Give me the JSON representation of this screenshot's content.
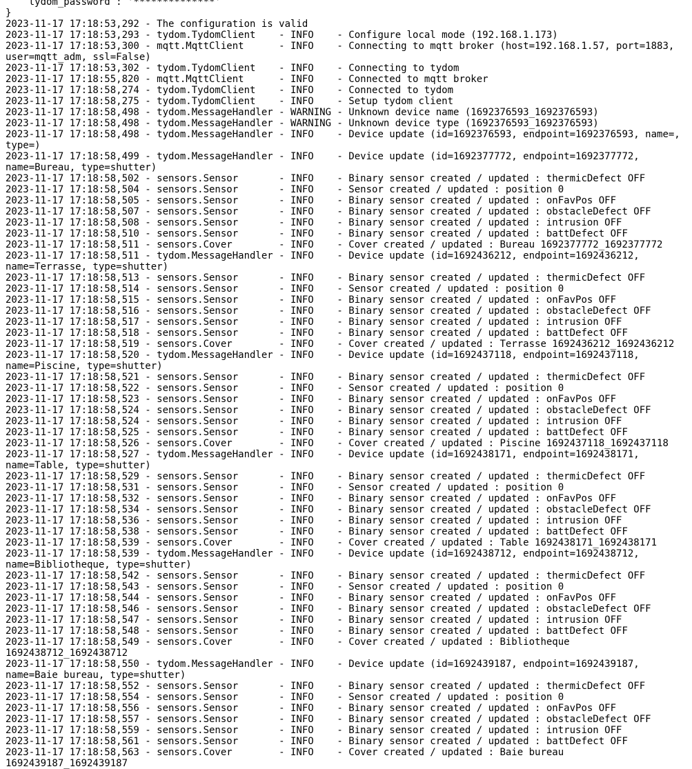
{
  "colors": {
    "background": "#ffffff",
    "text": "#000000"
  },
  "terminal": {
    "rows": [
      "    tydom_password : '**************'",
      "}",
      "2023-11-17 17:18:53,292 - The configuration is valid",
      "2023-11-17 17:18:53,293 - tydom.TydomClient    - INFO    - Configure local mode (192.168.1.173)",
      "2023-11-17 17:18:53,300 - mqtt.MqttClient      - INFO    - Connecting to mqtt broker (host=192.168.1.57, port=1883,",
      "user=mqtt_adm, ssl=False)",
      "2023-11-17 17:18:53,302 - tydom.TydomClient    - INFO    - Connecting to tydom",
      "2023-11-17 17:18:55,820 - mqtt.MqttClient      - INFO    - Connected to mqtt broker",
      "2023-11-17 17:18:58,274 - tydom.TydomClient    - INFO    - Connected to tydom",
      "2023-11-17 17:18:58,275 - tydom.TydomClient    - INFO    - Setup tydom client",
      "2023-11-17 17:18:58,498 - tydom.MessageHandler - WARNING - Unknown device name (1692376593_1692376593)",
      "2023-11-17 17:18:58,498 - tydom.MessageHandler - WARNING - Unknown device type (1692376593_1692376593)",
      "2023-11-17 17:18:58,498 - tydom.MessageHandler - INFO    - Device update (id=1692376593, endpoint=1692376593, name=,",
      "type=)",
      "2023-11-17 17:18:58,499 - tydom.MessageHandler - INFO    - Device update (id=1692377772, endpoint=1692377772,",
      "name=Bureau, type=shutter)",
      "2023-11-17 17:18:58,502 - sensors.Sensor       - INFO    - Binary sensor created / updated : thermicDefect OFF",
      "2023-11-17 17:18:58,504 - sensors.Sensor       - INFO    - Sensor created / updated : position 0",
      "2023-11-17 17:18:58,505 - sensors.Sensor       - INFO    - Binary sensor created / updated : onFavPos OFF",
      "2023-11-17 17:18:58,507 - sensors.Sensor       - INFO    - Binary sensor created / updated : obstacleDefect OFF",
      "2023-11-17 17:18:58,508 - sensors.Sensor       - INFO    - Binary sensor created / updated : intrusion OFF",
      "2023-11-17 17:18:58,510 - sensors.Sensor       - INFO    - Binary sensor created / updated : battDefect OFF",
      "2023-11-17 17:18:58,511 - sensors.Cover        - INFO    - Cover created / updated : Bureau 1692377772_1692377772",
      "2023-11-17 17:18:58,511 - tydom.MessageHandler - INFO    - Device update (id=1692436212, endpoint=1692436212,",
      "name=Terrasse, type=shutter)",
      "2023-11-17 17:18:58,513 - sensors.Sensor       - INFO    - Binary sensor created / updated : thermicDefect OFF",
      "2023-11-17 17:18:58,514 - sensors.Sensor       - INFO    - Sensor created / updated : position 0",
      "2023-11-17 17:18:58,515 - sensors.Sensor       - INFO    - Binary sensor created / updated : onFavPos OFF",
      "2023-11-17 17:18:58,516 - sensors.Sensor       - INFO    - Binary sensor created / updated : obstacleDefect OFF",
      "2023-11-17 17:18:58,517 - sensors.Sensor       - INFO    - Binary sensor created / updated : intrusion OFF",
      "2023-11-17 17:18:58,518 - sensors.Sensor       - INFO    - Binary sensor created / updated : battDefect OFF",
      "2023-11-17 17:18:58,519 - sensors.Cover        - INFO    - Cover created / updated : Terrasse 1692436212_1692436212",
      "2023-11-17 17:18:58,520 - tydom.MessageHandler - INFO    - Device update (id=1692437118, endpoint=1692437118,",
      "name=Piscine, type=shutter)",
      "2023-11-17 17:18:58,521 - sensors.Sensor       - INFO    - Binary sensor created / updated : thermicDefect OFF",
      "2023-11-17 17:18:58,522 - sensors.Sensor       - INFO    - Sensor created / updated : position 0",
      "2023-11-17 17:18:58,523 - sensors.Sensor       - INFO    - Binary sensor created / updated : onFavPos OFF",
      "2023-11-17 17:18:58,524 - sensors.Sensor       - INFO    - Binary sensor created / updated : obstacleDefect OFF",
      "2023-11-17 17:18:58,524 - sensors.Sensor       - INFO    - Binary sensor created / updated : intrusion OFF",
      "2023-11-17 17:18:58,525 - sensors.Sensor       - INFO    - Binary sensor created / updated : battDefect OFF",
      "2023-11-17 17:18:58,526 - sensors.Cover        - INFO    - Cover created / updated : Piscine 1692437118_1692437118",
      "2023-11-17 17:18:58,527 - tydom.MessageHandler - INFO    - Device update (id=1692438171, endpoint=1692438171,",
      "name=Table, type=shutter)",
      "2023-11-17 17:18:58,529 - sensors.Sensor       - INFO    - Binary sensor created / updated : thermicDefect OFF",
      "2023-11-17 17:18:58,531 - sensors.Sensor       - INFO    - Sensor created / updated : position 0",
      "2023-11-17 17:18:58,532 - sensors.Sensor       - INFO    - Binary sensor created / updated : onFavPos OFF",
      "2023-11-17 17:18:58,534 - sensors.Sensor       - INFO    - Binary sensor created / updated : obstacleDefect OFF",
      "2023-11-17 17:18:58,536 - sensors.Sensor       - INFO    - Binary sensor created / updated : intrusion OFF",
      "2023-11-17 17:18:58,538 - sensors.Sensor       - INFO    - Binary sensor created / updated : battDefect OFF",
      "2023-11-17 17:18:58,539 - sensors.Cover        - INFO    - Cover created / updated : Table 1692438171_1692438171",
      "2023-11-17 17:18:58,539 - tydom.MessageHandler - INFO    - Device update (id=1692438712, endpoint=1692438712,",
      "name=Bibliotheque, type=shutter)",
      "2023-11-17 17:18:58,542 - sensors.Sensor       - INFO    - Binary sensor created / updated : thermicDefect OFF",
      "2023-11-17 17:18:58,543 - sensors.Sensor       - INFO    - Sensor created / updated : position 0",
      "2023-11-17 17:18:58,544 - sensors.Sensor       - INFO    - Binary sensor created / updated : onFavPos OFF",
      "2023-11-17 17:18:58,546 - sensors.Sensor       - INFO    - Binary sensor created / updated : obstacleDefect OFF",
      "2023-11-17 17:18:58,547 - sensors.Sensor       - INFO    - Binary sensor created / updated : intrusion OFF",
      "2023-11-17 17:18:58,548 - sensors.Sensor       - INFO    - Binary sensor created / updated : battDefect OFF",
      "2023-11-17 17:18:58,549 - sensors.Cover        - INFO    - Cover created / updated : Bibliotheque",
      "1692438712_1692438712",
      "2023-11-17 17:18:58,550 - tydom.MessageHandler - INFO    - Device update (id=1692439187, endpoint=1692439187,",
      "name=Baie bureau, type=shutter)",
      "2023-11-17 17:18:58,552 - sensors.Sensor       - INFO    - Binary sensor created / updated : thermicDefect OFF",
      "2023-11-17 17:18:58,554 - sensors.Sensor       - INFO    - Sensor created / updated : position 0",
      "2023-11-17 17:18:58,556 - sensors.Sensor       - INFO    - Binary sensor created / updated : onFavPos OFF",
      "2023-11-17 17:18:58,557 - sensors.Sensor       - INFO    - Binary sensor created / updated : obstacleDefect OFF",
      "2023-11-17 17:18:58,559 - sensors.Sensor       - INFO    - Binary sensor created / updated : intrusion OFF",
      "2023-11-17 17:18:58,561 - sensors.Sensor       - INFO    - Binary sensor created / updated : battDefect OFF",
      "2023-11-17 17:18:58,563 - sensors.Cover        - INFO    - Cover created / updated : Baie bureau",
      "1692439187_1692439187"
    ]
  }
}
